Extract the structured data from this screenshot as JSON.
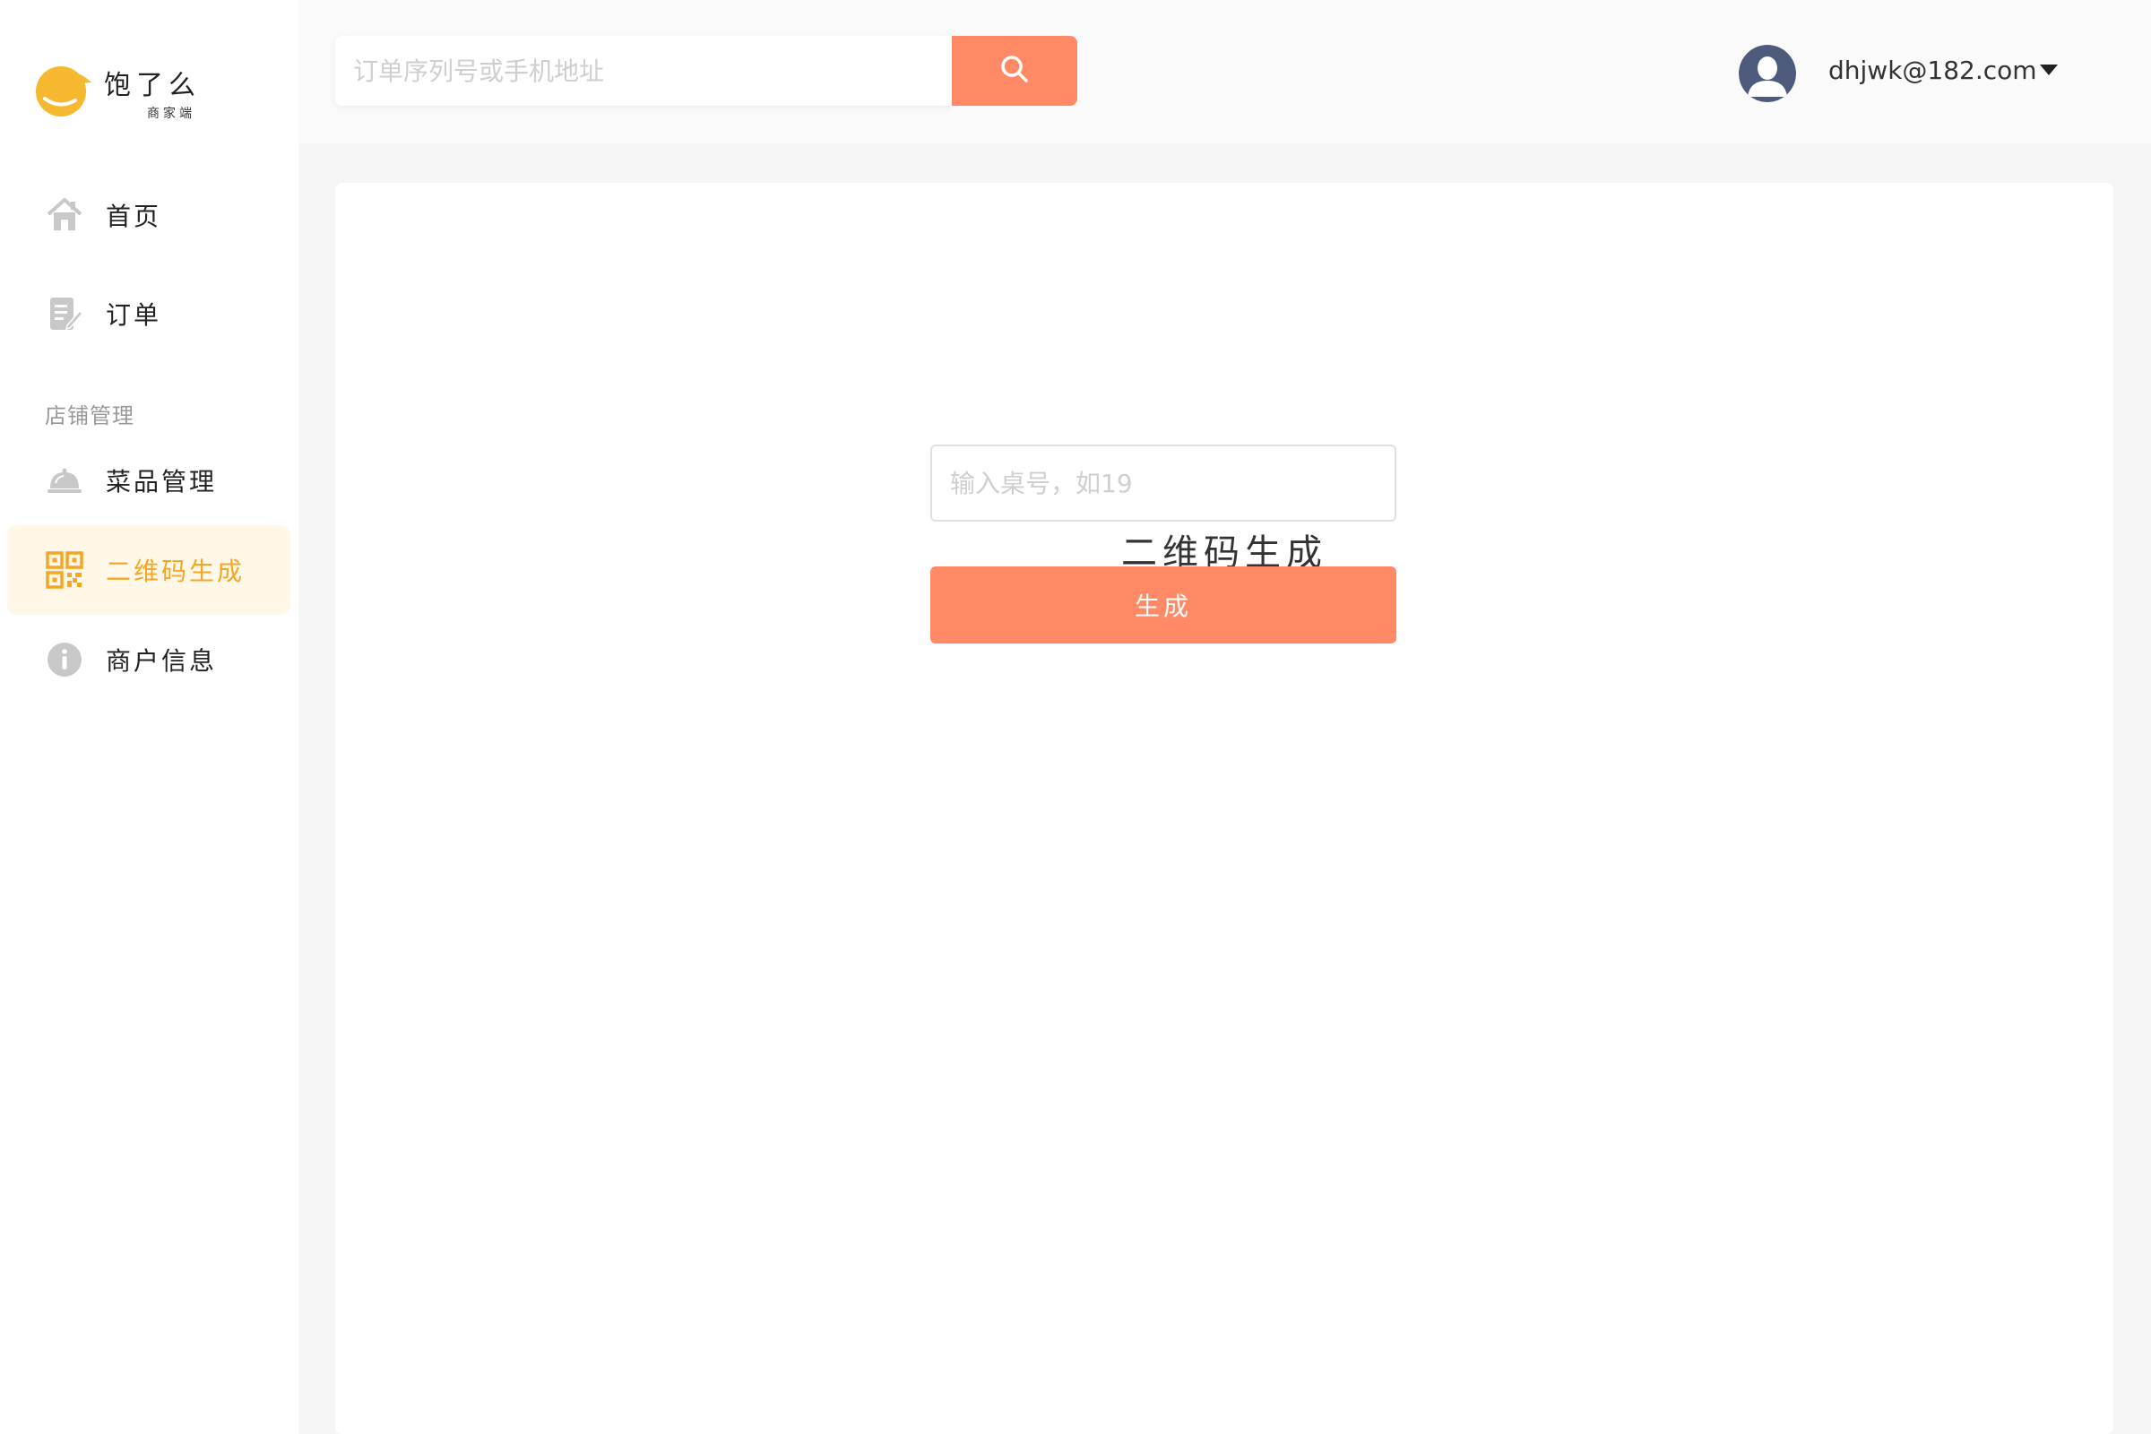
{
  "brand": {
    "name": "饱了么",
    "subtitle": "商家端",
    "color": "#f5b82e"
  },
  "sidebar": {
    "items": [
      {
        "label": "首页",
        "icon": "home-icon",
        "active": false
      },
      {
        "label": "订单",
        "icon": "order-icon",
        "active": false
      }
    ],
    "section_title": "店铺管理",
    "section_items": [
      {
        "label": "菜品管理",
        "icon": "dish-cover-icon",
        "active": false
      },
      {
        "label": "二维码生成",
        "icon": "qrcode-icon",
        "active": true
      },
      {
        "label": "商户信息",
        "icon": "info-icon",
        "active": false
      }
    ]
  },
  "header": {
    "search_placeholder": "订单序列号或手机地址",
    "search_value": "",
    "user_email": "dhjwk@182.com"
  },
  "main": {
    "title": "二维码生成",
    "table_input_placeholder": "输入桌号，如19",
    "table_input_value": "",
    "generate_label": "生成"
  },
  "colors": {
    "accent": "#ff8a65",
    "active_text": "#f5a623",
    "active_bg": "#fff8e8",
    "icon_gray": "#c8c8c8"
  }
}
